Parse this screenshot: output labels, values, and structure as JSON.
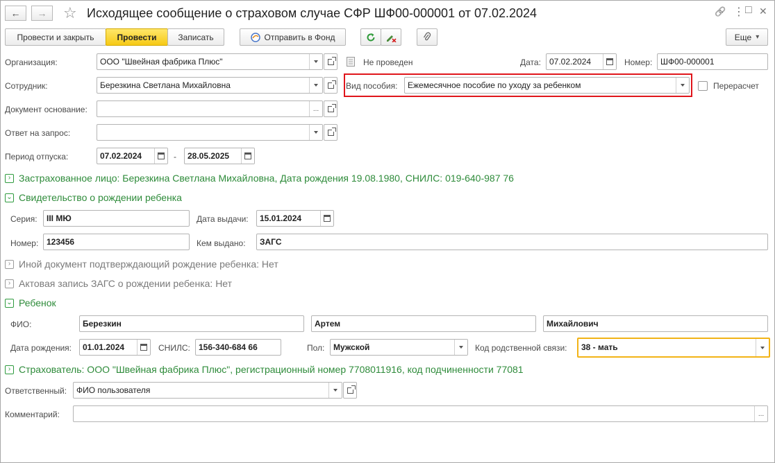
{
  "window": {
    "title": "Исходящее сообщение о страховом случае СФР ШФ00-000001 от 07.02.2024",
    "back_glyph": "←",
    "forward_glyph": "→",
    "star_glyph": "☆",
    "link_glyph": "🔗",
    "more_glyph": "⋮",
    "maximize_glyph": "□",
    "close_glyph": "✕"
  },
  "toolbar": {
    "post_close_label": "Провести и закрыть",
    "post_label": "Провести",
    "save_label": "Записать",
    "send_label": "Отправить в Фонд",
    "more_label": "Еще",
    "more_arrow": "▾"
  },
  "form": {
    "organization": {
      "label": "Организация:",
      "value": "ООО \"Швейная фабрика Плюс\""
    },
    "employee": {
      "label": "Сотрудник:",
      "value": "Березкина Светлана Михайловна"
    },
    "base_doc": {
      "label": "Документ основание:",
      "value": ""
    },
    "reply_to": {
      "label": "Ответ на запрос:",
      "value": ""
    },
    "leave_period": {
      "label": "Период отпуска:",
      "from": "07.02.2024",
      "dash": "-",
      "to": "28.05.2025"
    },
    "status": "Не проведен",
    "date": {
      "label": "Дата:",
      "value": "07.02.2024"
    },
    "number": {
      "label": "Номер:",
      "value": "ШФ00-000001"
    },
    "benefit_type": {
      "label": "Вид пособия:",
      "value": "Ежемесячное пособие по уходу за ребенком"
    },
    "recalc": {
      "label": "Перерасчет",
      "checked": false
    },
    "dots": "..."
  },
  "sections": {
    "insured": "Застрахованное лицо: Березкина Светлана Михайловна, Дата рождения 19.08.1980, СНИЛС: 019-640-987 76",
    "birth_cert": "Свидетельство о рождении ребенка",
    "other_doc": "Иной документ подтверждающий рождение ребенка: Нет",
    "zags_record": "Актовая запись ЗАГС о рождении ребенка: Нет",
    "child": "Ребенок",
    "insurer": "Страхователь: ООО \"Швейная фабрика Плюс\", регистрационный номер 7708011916, код подчиненности 77081",
    "expanded_glyph": "⌄",
    "collapsed_glyph": "›"
  },
  "birth_cert": {
    "series": {
      "label": "Серия:",
      "value": "III МЮ"
    },
    "issue_date": {
      "label": "Дата выдачи:",
      "value": "15.01.2024"
    },
    "number": {
      "label": "Номер:",
      "value": "123456"
    },
    "issued_by": {
      "label": "Кем выдано:",
      "value": "ЗАГС"
    }
  },
  "child": {
    "fio_label": "ФИО:",
    "last_name": "Березкин",
    "first_name": "Артем",
    "middle_name": "Михайлович",
    "birth_date": {
      "label": "Дата рождения:",
      "value": "01.01.2024"
    },
    "snils": {
      "label": "СНИЛС:",
      "value": "156-340-684 66"
    },
    "gender": {
      "label": "Пол:",
      "value": "Мужской"
    },
    "relation": {
      "label": "Код родственной связи:",
      "value": "38 - мать"
    }
  },
  "footer": {
    "responsible": {
      "label": "Ответственный:",
      "value": "ФИО пользователя"
    },
    "comment": {
      "label": "Комментарий:",
      "value": ""
    }
  },
  "colors": {
    "accent_yellow": "#f6c915",
    "section_green": "#2e8b3a",
    "highlight_red": "#e0151b",
    "focus_orange": "#f2b316"
  }
}
